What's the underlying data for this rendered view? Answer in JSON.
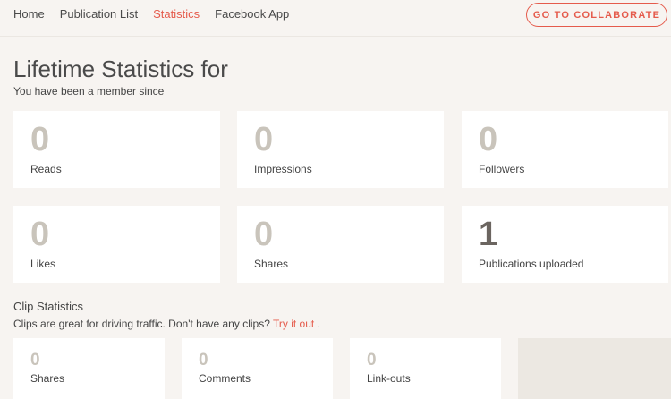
{
  "nav": {
    "items": [
      {
        "label": "Home",
        "active": false
      },
      {
        "label": "Publication List",
        "active": false
      },
      {
        "label": "Statistics",
        "active": true
      },
      {
        "label": "Facebook App",
        "active": false
      }
    ],
    "collaborate_label": "GO TO COLLABORATE"
  },
  "header": {
    "title": "Lifetime Statistics for",
    "member_since": "You have been a member since"
  },
  "stats": [
    {
      "value": "0",
      "label": "Reads"
    },
    {
      "value": "0",
      "label": "Impressions"
    },
    {
      "value": "0",
      "label": "Followers"
    },
    {
      "value": "0",
      "label": "Likes"
    },
    {
      "value": "0",
      "label": "Shares"
    },
    {
      "value": "1",
      "label": "Publications uploaded"
    }
  ],
  "clips": {
    "title": "Clip Statistics",
    "desc_text": "Clips are great for driving traffic. Don't have any clips?",
    "link_text": "Try it out",
    "desc_end": ".",
    "items": [
      {
        "value": "0",
        "label": "Shares"
      },
      {
        "value": "0",
        "label": "Comments"
      },
      {
        "value": "0",
        "label": "Link-outs"
      }
    ]
  },
  "colors": {
    "accent": "#e55b4c",
    "background": "#f7f4f1",
    "zero_number": "#c9c4bb",
    "nonzero_number": "#6b6560"
  }
}
